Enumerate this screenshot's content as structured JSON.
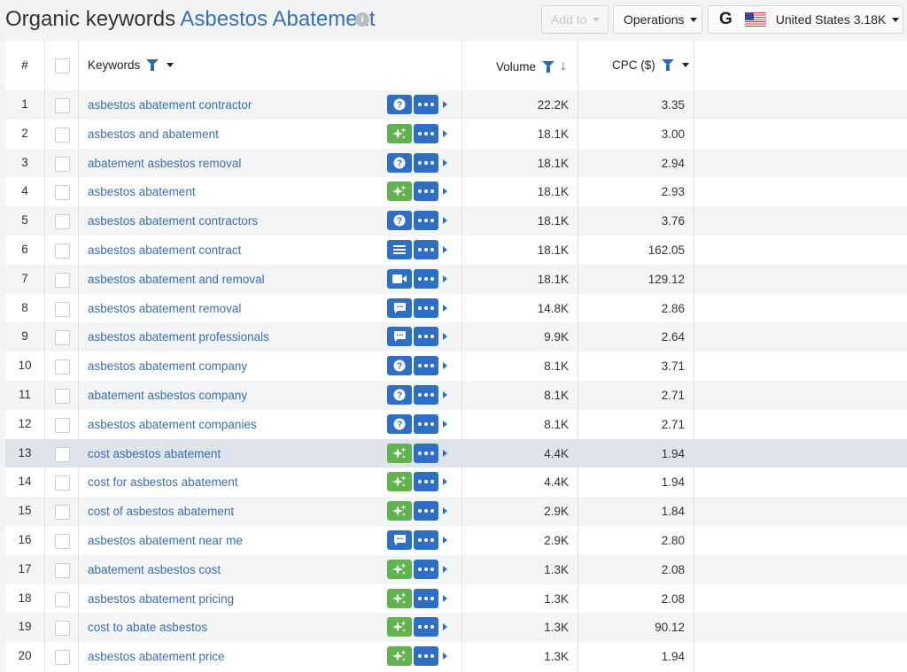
{
  "header": {
    "title_prefix": "Organic keywords",
    "title_topic": "Asbestos Abatement",
    "add_to_label": "Add to",
    "operations_label": "Operations",
    "engine_label": "G",
    "country_label": "United States 3.18K"
  },
  "columns": {
    "num": "#",
    "keywords": "Keywords",
    "volume": "Volume",
    "cpc": "CPC ($)"
  },
  "rows": [
    {
      "num": "1",
      "keyword": "asbestos abatement contractor",
      "intent": "question",
      "volume": "22.2K",
      "cpc": "3.35"
    },
    {
      "num": "2",
      "keyword": "asbestos and abatement",
      "intent": "sparkle",
      "volume": "18.1K",
      "cpc": "3.00"
    },
    {
      "num": "3",
      "keyword": "abatement asbestos removal",
      "intent": "question",
      "volume": "18.1K",
      "cpc": "2.94"
    },
    {
      "num": "4",
      "keyword": "asbestos abatement",
      "intent": "sparkle",
      "volume": "18.1K",
      "cpc": "2.93"
    },
    {
      "num": "5",
      "keyword": "asbestos abatement contractors",
      "intent": "question",
      "volume": "18.1K",
      "cpc": "3.76"
    },
    {
      "num": "6",
      "keyword": "asbestos abatement contract",
      "intent": "list",
      "volume": "18.1K",
      "cpc": "162.05"
    },
    {
      "num": "7",
      "keyword": "asbestos abatement and removal",
      "intent": "video",
      "volume": "18.1K",
      "cpc": "129.12"
    },
    {
      "num": "8",
      "keyword": "asbestos abatement removal",
      "intent": "chat",
      "volume": "14.8K",
      "cpc": "2.86"
    },
    {
      "num": "9",
      "keyword": "asbestos abatement professionals",
      "intent": "chat",
      "volume": "9.9K",
      "cpc": "2.64"
    },
    {
      "num": "10",
      "keyword": "asbestos abatement company",
      "intent": "question",
      "volume": "8.1K",
      "cpc": "3.71"
    },
    {
      "num": "11",
      "keyword": "abatement asbestos company",
      "intent": "question",
      "volume": "8.1K",
      "cpc": "2.71"
    },
    {
      "num": "12",
      "keyword": "asbestos abatement companies",
      "intent": "question",
      "volume": "8.1K",
      "cpc": "2.71"
    },
    {
      "num": "13",
      "keyword": "cost asbestos abatement",
      "intent": "sparkle",
      "volume": "4.4K",
      "cpc": "1.94",
      "selected": true
    },
    {
      "num": "14",
      "keyword": "cost for asbestos abatement",
      "intent": "sparkle",
      "volume": "4.4K",
      "cpc": "1.94"
    },
    {
      "num": "15",
      "keyword": "cost of asbestos abatement",
      "intent": "sparkle",
      "volume": "2.9K",
      "cpc": "1.84"
    },
    {
      "num": "16",
      "keyword": "asbestos abatement near me",
      "intent": "chat",
      "volume": "2.9K",
      "cpc": "2.80"
    },
    {
      "num": "17",
      "keyword": "abatement asbestos cost",
      "intent": "sparkle",
      "volume": "1.3K",
      "cpc": "2.08"
    },
    {
      "num": "18",
      "keyword": "asbestos abatement pricing",
      "intent": "sparkle",
      "volume": "1.3K",
      "cpc": "2.08"
    },
    {
      "num": "19",
      "keyword": "cost to abate asbestos",
      "intent": "sparkle",
      "volume": "1.3K",
      "cpc": "90.12"
    },
    {
      "num": "20",
      "keyword": "asbestos abatement price",
      "intent": "sparkle",
      "volume": "1.3K",
      "cpc": "1.94"
    }
  ],
  "colors": {
    "accent": "#2f6ec5",
    "link": "#3a6fb0",
    "intent_green": "#62b34f",
    "row_alt": "#f3f4f6",
    "row_selected": "#dfe3ea"
  }
}
